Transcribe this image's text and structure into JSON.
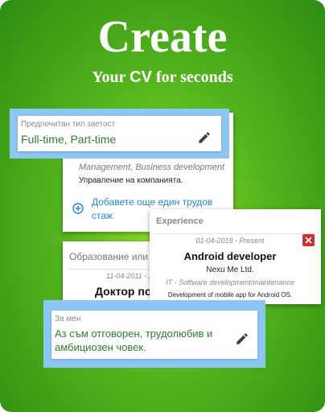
{
  "header": {
    "title": "Create",
    "subtitle_prefix": "Your ",
    "subtitle_highlight": "CV",
    "subtitle_suffix": " for seconds"
  },
  "employment_type": {
    "label": "Предпочитан тип заетост",
    "value": "Full-time, Part-time"
  },
  "work_card": {
    "position_line": "Management, Business development",
    "description": "Управление на компанията.",
    "add_label_line1": "Добавете още един трудов",
    "add_label_line2": "стаж"
  },
  "education_card": {
    "section_title": "Образование или с",
    "date": "11-04-2011 - 2",
    "degree": "Доктор по"
  },
  "experience_card": {
    "section_title": "Experience",
    "date": "01-04-2018 - Present",
    "job_title": "Android developer",
    "company": "Nexu Me Ltd.",
    "field": "IT - Software development/maintenance",
    "description": "Development of mobile app for Android OS."
  },
  "about_card": {
    "label": "За мен",
    "value_line1": "Аз съм отговорен, трудолюбив и",
    "value_line2": "амбициозен човек."
  },
  "colors": {
    "value_green": "#2e7d32",
    "link_blue": "#1e88e5",
    "highlight_blue": "#8ec6f3",
    "delete_red": "#d32f2f"
  },
  "icons": [
    "pencil-icon",
    "plus-circle-icon",
    "delete-icon"
  ]
}
